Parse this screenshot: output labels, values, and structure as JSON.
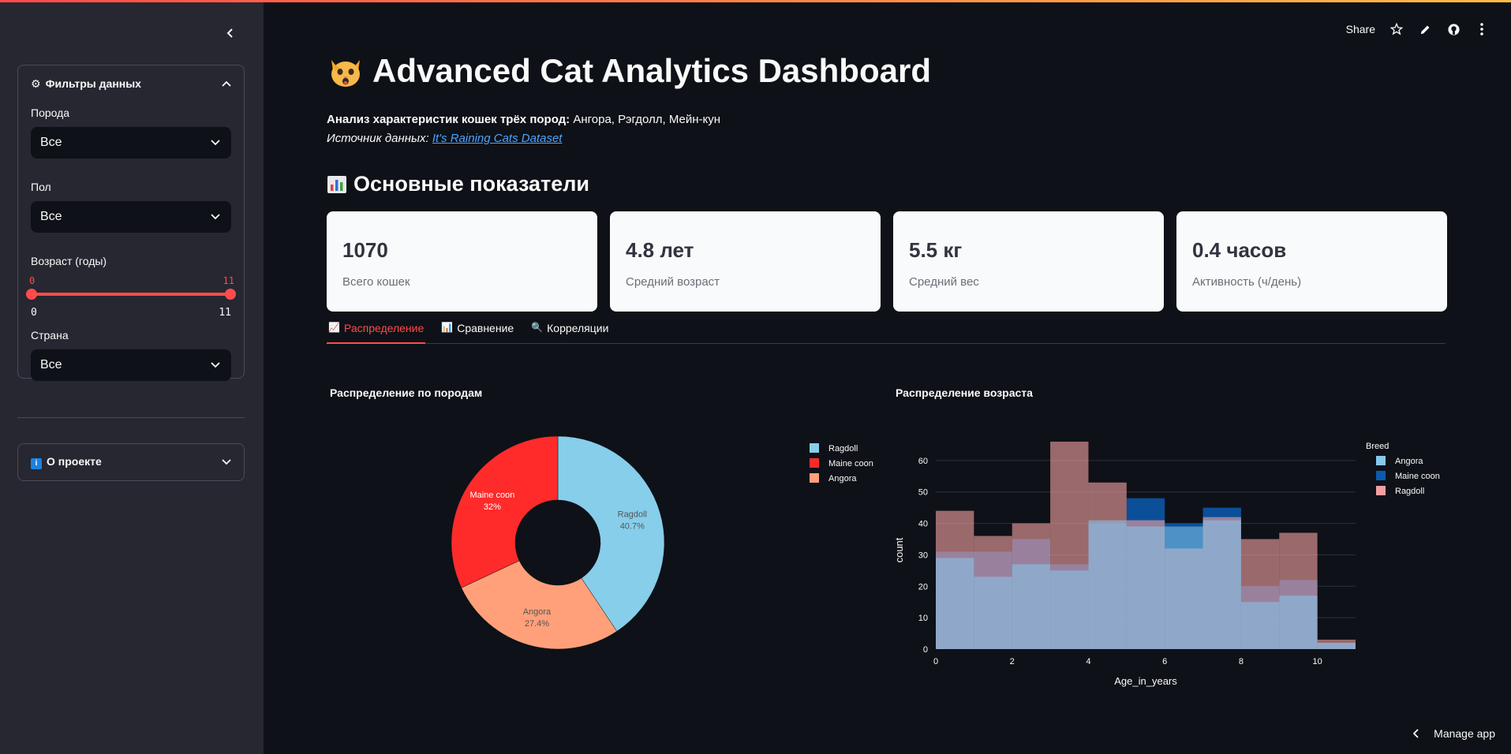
{
  "sidebar": {
    "filters_title": "Фильтры данных",
    "breed_label": "Порода",
    "breed_value": "Все",
    "sex_label": "Пол",
    "sex_value": "Все",
    "age_label": "Возраст (годы)",
    "age_min": "0",
    "age_max": "11",
    "age_range": [
      0,
      11
    ],
    "country_label": "Страна",
    "country_value": "Все",
    "about_label": "О проекте"
  },
  "header": {
    "share_label": "Share"
  },
  "main": {
    "title": "Advanced Cat Analytics Dashboard",
    "subtitle_bold": "Анализ характеристик кошек трёх пород:",
    "subtitle_rest": " Ангора, Рэгдолл, Мейн-кун",
    "source_label": "Источник данных: ",
    "source_link": "It's Raining Cats Dataset",
    "section_title": "Основные показатели",
    "metrics": [
      {
        "value": "1070",
        "label": "Всего кошек"
      },
      {
        "value": "4.8 лет",
        "label": "Средний возраст"
      },
      {
        "value": "5.5 кг",
        "label": "Средний вес"
      },
      {
        "value": "0.4 часов",
        "label": "Активность (ч/день)"
      }
    ],
    "tabs": [
      {
        "label": "Распределение"
      },
      {
        "label": "Сравнение"
      },
      {
        "label": "Корреляции"
      }
    ],
    "pie_title": "Распределение по породам",
    "hist_title": "Распределение возраста"
  },
  "colors": {
    "accent": "#ff4b4b",
    "ragdoll": "#87ceeb",
    "maine_coon": "#ff2b2b",
    "angora": "#ffa07a",
    "hist_angora": "#87c8ed",
    "hist_maine": "#0a5bb0",
    "hist_ragdoll": "#f0a0a0"
  },
  "footer": {
    "manage_label": "Manage app"
  },
  "chart_data": [
    {
      "type": "pie",
      "title": "Распределение по породам",
      "labels": [
        "Ragdoll",
        "Maine coon",
        "Angora"
      ],
      "values": [
        40.7,
        32,
        27.4
      ],
      "value_labels": [
        "40.7%",
        "32%",
        "27.4%"
      ],
      "legend_position": "right",
      "hole": true
    },
    {
      "type": "bar",
      "title": "Распределение возраста",
      "xlabel": "Age_in_years",
      "ylabel": "count",
      "legend_title": "Breed",
      "legend_position": "top-right",
      "xlim": [
        0,
        11
      ],
      "ylim": [
        0,
        68
      ],
      "xticks": [
        0,
        2,
        4,
        6,
        8,
        10
      ],
      "yticks": [
        0,
        10,
        20,
        30,
        40,
        50,
        60
      ],
      "bins": [
        [
          0,
          1
        ],
        [
          1,
          2
        ],
        [
          2,
          3
        ],
        [
          3,
          4
        ],
        [
          4,
          5
        ],
        [
          5,
          6
        ],
        [
          6,
          7
        ],
        [
          7,
          8
        ],
        [
          8,
          9
        ],
        [
          9,
          10
        ],
        [
          10,
          11
        ]
      ],
      "series": [
        {
          "name": "Angora",
          "values": [
            29,
            23,
            27,
            25,
            41,
            39,
            39,
            41,
            15,
            17,
            2
          ]
        },
        {
          "name": "Maine coon",
          "values": [
            31,
            31,
            35,
            27,
            40,
            48,
            40,
            45,
            20,
            22,
            2
          ]
        },
        {
          "name": "Ragdoll",
          "values": [
            44,
            36,
            40,
            66,
            53,
            41,
            32,
            42,
            35,
            37,
            3
          ]
        }
      ]
    }
  ]
}
